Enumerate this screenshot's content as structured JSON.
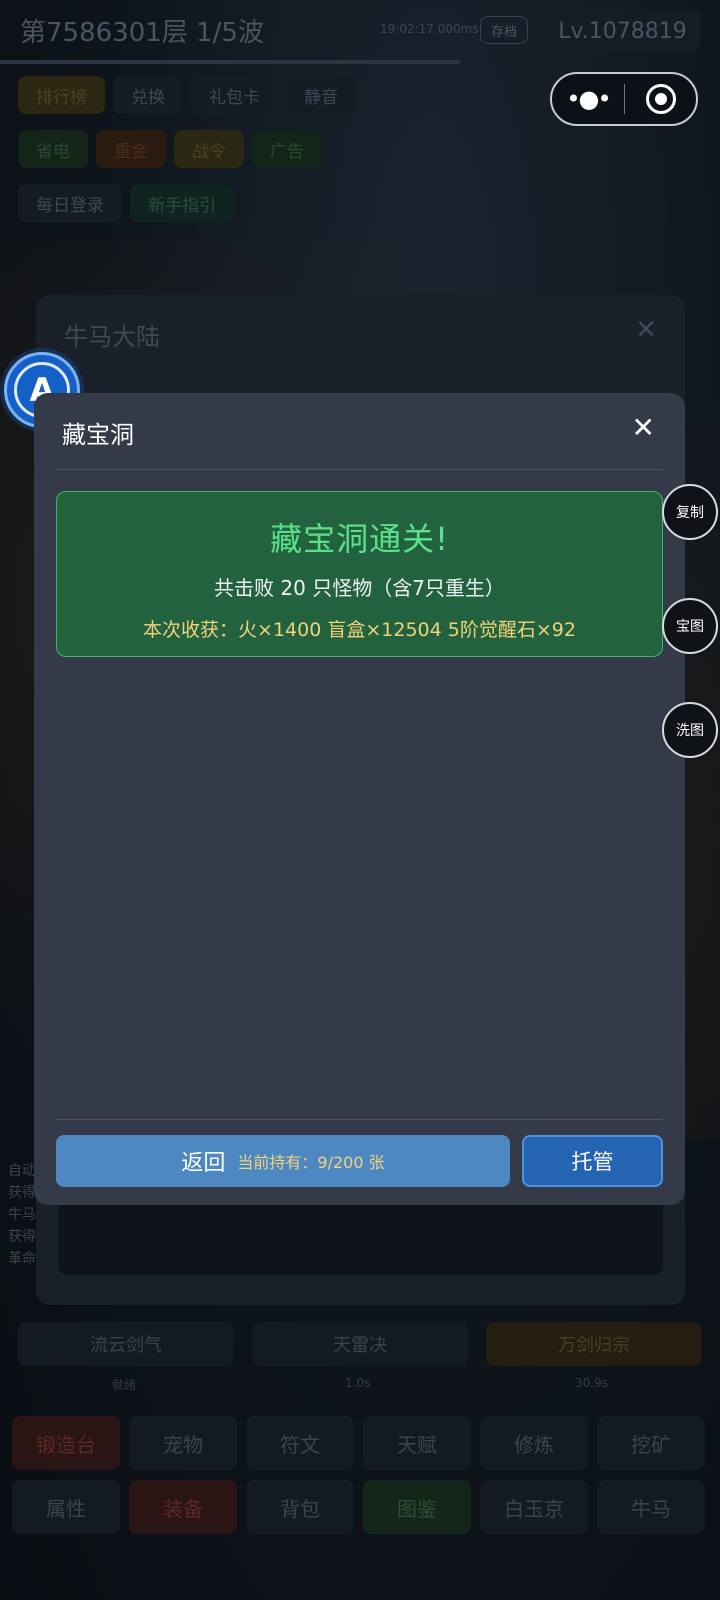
{
  "topbar": {
    "floor_wave": "第7586301层  1/5波",
    "time": "19:02:17.000ms",
    "save_label": "存档",
    "level": "Lv.1078819"
  },
  "menu_rows": {
    "row1": [
      "排行榜",
      "兑换",
      "礼包卡",
      "静音"
    ],
    "row2": [
      "省电",
      "重金",
      "战令",
      "广告"
    ],
    "row3": [
      "每日登录",
      "新手指引"
    ]
  },
  "skills": {
    "items": [
      "流云剑气",
      "天雷决",
      "万剑归宗"
    ],
    "subs": [
      "就绪",
      "1.0s",
      "30.9s"
    ]
  },
  "bottom_nav": [
    "锻造台",
    "宠物",
    "符文",
    "天赋",
    "修炼",
    "挖矿",
    "属性",
    "装备",
    "背包",
    "图鉴",
    "白玉京",
    "牛马"
  ],
  "side_log": [
    "自动",
    "获得",
    "牛马",
    "获得",
    "革命"
  ],
  "outer_panel": {
    "title": "牛马大陆",
    "close": "✕"
  },
  "badge": {
    "letter": "A"
  },
  "modal": {
    "title": "藏宝洞",
    "close": "✕",
    "result": {
      "headline": "藏宝洞通关!",
      "kills": "共击败 20 只怪物（含7只重生）",
      "loot": "本次收获：火×1400  盲盒×12504  5阶觉醒石×92"
    },
    "back_label": "返回",
    "hold_label": "当前持有：9/200 张",
    "auto_label": "托管"
  },
  "side_buttons": [
    "复制",
    "宝图",
    "洗图"
  ],
  "colors": {
    "modal_bg": "#343a47",
    "result_bg": "#22623f",
    "result_title": "#5de08c",
    "loot_text": "#f1d37a",
    "back_btn": "#4e88c3",
    "auto_btn": "#2563b3"
  }
}
